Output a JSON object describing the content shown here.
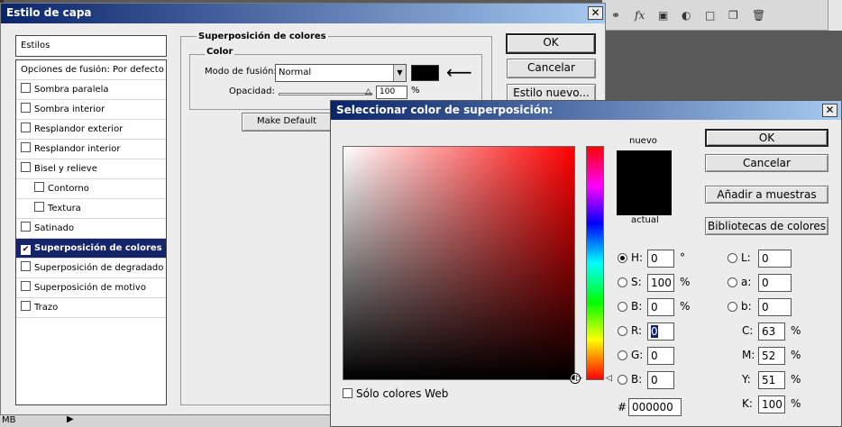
{
  "topbar": {
    "fx_label": "fx"
  },
  "layer_style": {
    "title": "Estilo de capa",
    "styles_header": "Estilos",
    "styles": [
      {
        "label": "Opciones de fusión: Por defecto",
        "checkbox": false,
        "checked": false,
        "indent": false
      },
      {
        "label": "Sombra paralela",
        "checkbox": true,
        "checked": false,
        "indent": false
      },
      {
        "label": "Sombra interior",
        "checkbox": true,
        "checked": false,
        "indent": false
      },
      {
        "label": "Resplandor exterior",
        "checkbox": true,
        "checked": false,
        "indent": false
      },
      {
        "label": "Resplandor interior",
        "checkbox": true,
        "checked": false,
        "indent": false
      },
      {
        "label": "Bisel y relieve",
        "checkbox": true,
        "checked": false,
        "indent": false
      },
      {
        "label": "Contorno",
        "checkbox": true,
        "checked": false,
        "indent": true
      },
      {
        "label": "Textura",
        "checkbox": true,
        "checked": false,
        "indent": true
      },
      {
        "label": "Satinado",
        "checkbox": true,
        "checked": false,
        "indent": false
      },
      {
        "label": "Superposición de colores",
        "checkbox": true,
        "checked": true,
        "indent": false,
        "selected": true
      },
      {
        "label": "Superposición de degradado",
        "checkbox": true,
        "checked": false,
        "indent": false
      },
      {
        "label": "Superposición de motivo",
        "checkbox": true,
        "checked": false,
        "indent": false
      },
      {
        "label": "Trazo",
        "checkbox": true,
        "checked": false,
        "indent": false
      }
    ],
    "section_title": "Superposición de colores",
    "color_group": "Color",
    "blend_mode_label": "Modo de fusión:",
    "blend_mode_value": "Normal",
    "opacity_label": "Opacidad:",
    "opacity_value": "100",
    "opacity_unit": "%",
    "opacity_fraction": 1.0,
    "make_default": "Make Default",
    "ok": "OK",
    "cancel": "Cancelar",
    "new_style": "Estilo nuevo...",
    "overlay_color": "#000000"
  },
  "picker": {
    "title": "Seleccionar color de superposición:",
    "new_label": "nuevo",
    "current_label": "actual",
    "ok": "OK",
    "cancel": "Cancelar",
    "add_swatches": "Añadir a muestras",
    "libraries": "Bibliotecas de colores",
    "web_only": "Sólo colores Web",
    "hsb": [
      {
        "label": "H:",
        "value": "0",
        "unit": "°",
        "selected": true
      },
      {
        "label": "S:",
        "value": "100",
        "unit": "%",
        "selected": false
      },
      {
        "label": "B:",
        "value": "0",
        "unit": "%",
        "selected": false
      }
    ],
    "rgb": [
      {
        "label": "R:",
        "value": "0",
        "selected": false
      },
      {
        "label": "G:",
        "value": "0",
        "selected": false
      },
      {
        "label": "B:",
        "value": "0",
        "selected": false
      }
    ],
    "lab": [
      {
        "label": "L:",
        "value": "0"
      },
      {
        "label": "a:",
        "value": "0"
      },
      {
        "label": "b:",
        "value": "0"
      }
    ],
    "cmyk": [
      {
        "label": "C:",
        "value": "63",
        "unit": "%"
      },
      {
        "label": "M:",
        "value": "52",
        "unit": "%"
      },
      {
        "label": "Y:",
        "value": "51",
        "unit": "%"
      },
      {
        "label": "K:",
        "value": "100",
        "unit": "%"
      }
    ],
    "hex_label": "#",
    "hex_value": "000000",
    "new_color": "#000000",
    "current_color": "#000000"
  },
  "statusbar": {
    "text": "MB"
  },
  "colors": {
    "title_gradient_start": "#0a246a",
    "title_gradient_end": "#a6caf0",
    "selection": "#16246a"
  }
}
